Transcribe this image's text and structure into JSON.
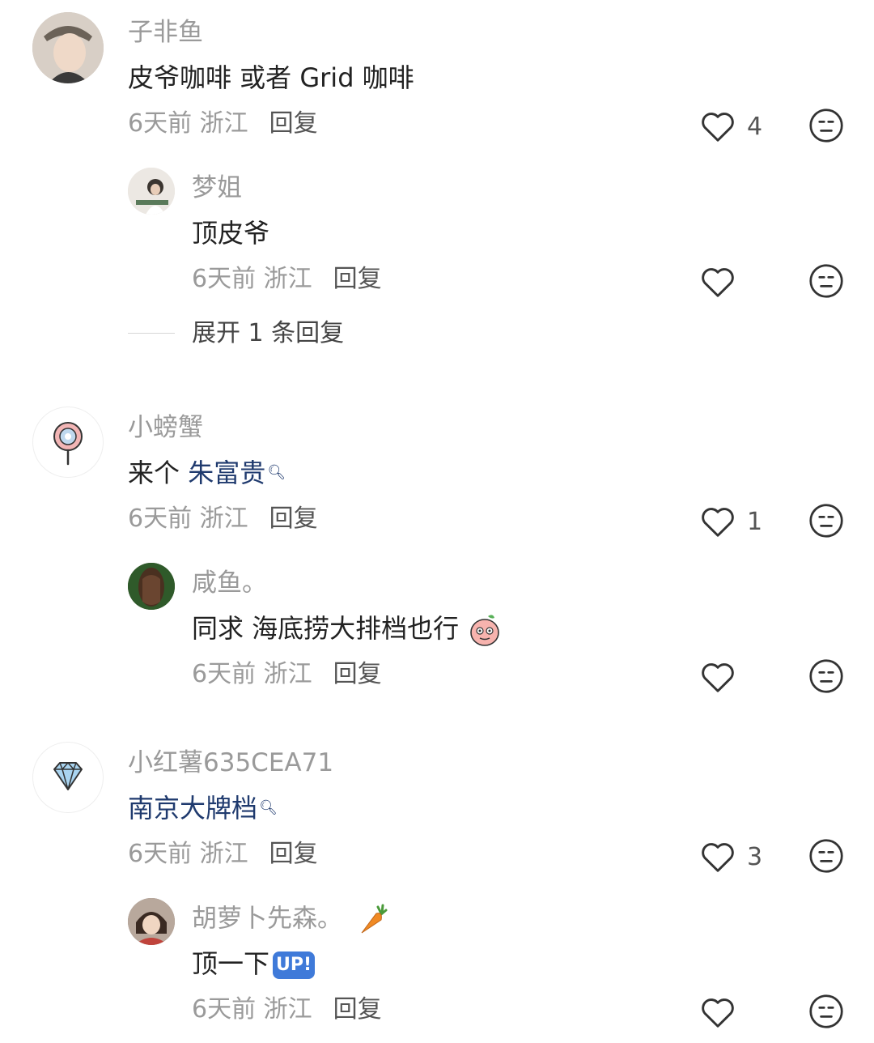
{
  "comments": [
    {
      "user": "子非鱼",
      "text": "皮爷咖啡 或者 Grid 咖啡",
      "meta": "6天前 浙江",
      "reply": "回复",
      "likes": "4",
      "replies": [
        {
          "user": "梦姐",
          "text": "顶皮爷",
          "meta": "6天前 浙江",
          "reply": "回复",
          "likes": ""
        }
      ],
      "expand": "展开 1 条回复"
    },
    {
      "user": "小螃蟹",
      "text_prefix": "来个 ",
      "text_link": "朱富贵",
      "meta": "6天前 浙江",
      "reply": "回复",
      "likes": "1",
      "replies": [
        {
          "user": "咸鱼。",
          "text": "同求 海底捞大排档也行",
          "meta": "6天前 浙江",
          "reply": "回复",
          "likes": ""
        }
      ]
    },
    {
      "user": "小红薯635CEA71",
      "text_link": "南京大牌档",
      "meta": "6天前 浙江",
      "reply": "回复",
      "likes": "3",
      "replies": [
        {
          "user": "胡萝卜先森。",
          "text": "顶一下",
          "badge": "UP!",
          "meta": "6天前 浙江",
          "reply": "回复",
          "likes": ""
        }
      ]
    }
  ],
  "icons": {
    "like": "heart-outline-icon",
    "dislike": "meh-face-icon",
    "search_hint": "search-icon"
  },
  "colors": {
    "link": "#1f3a6e",
    "meta": "#9a9a9a",
    "text": "#222222"
  }
}
